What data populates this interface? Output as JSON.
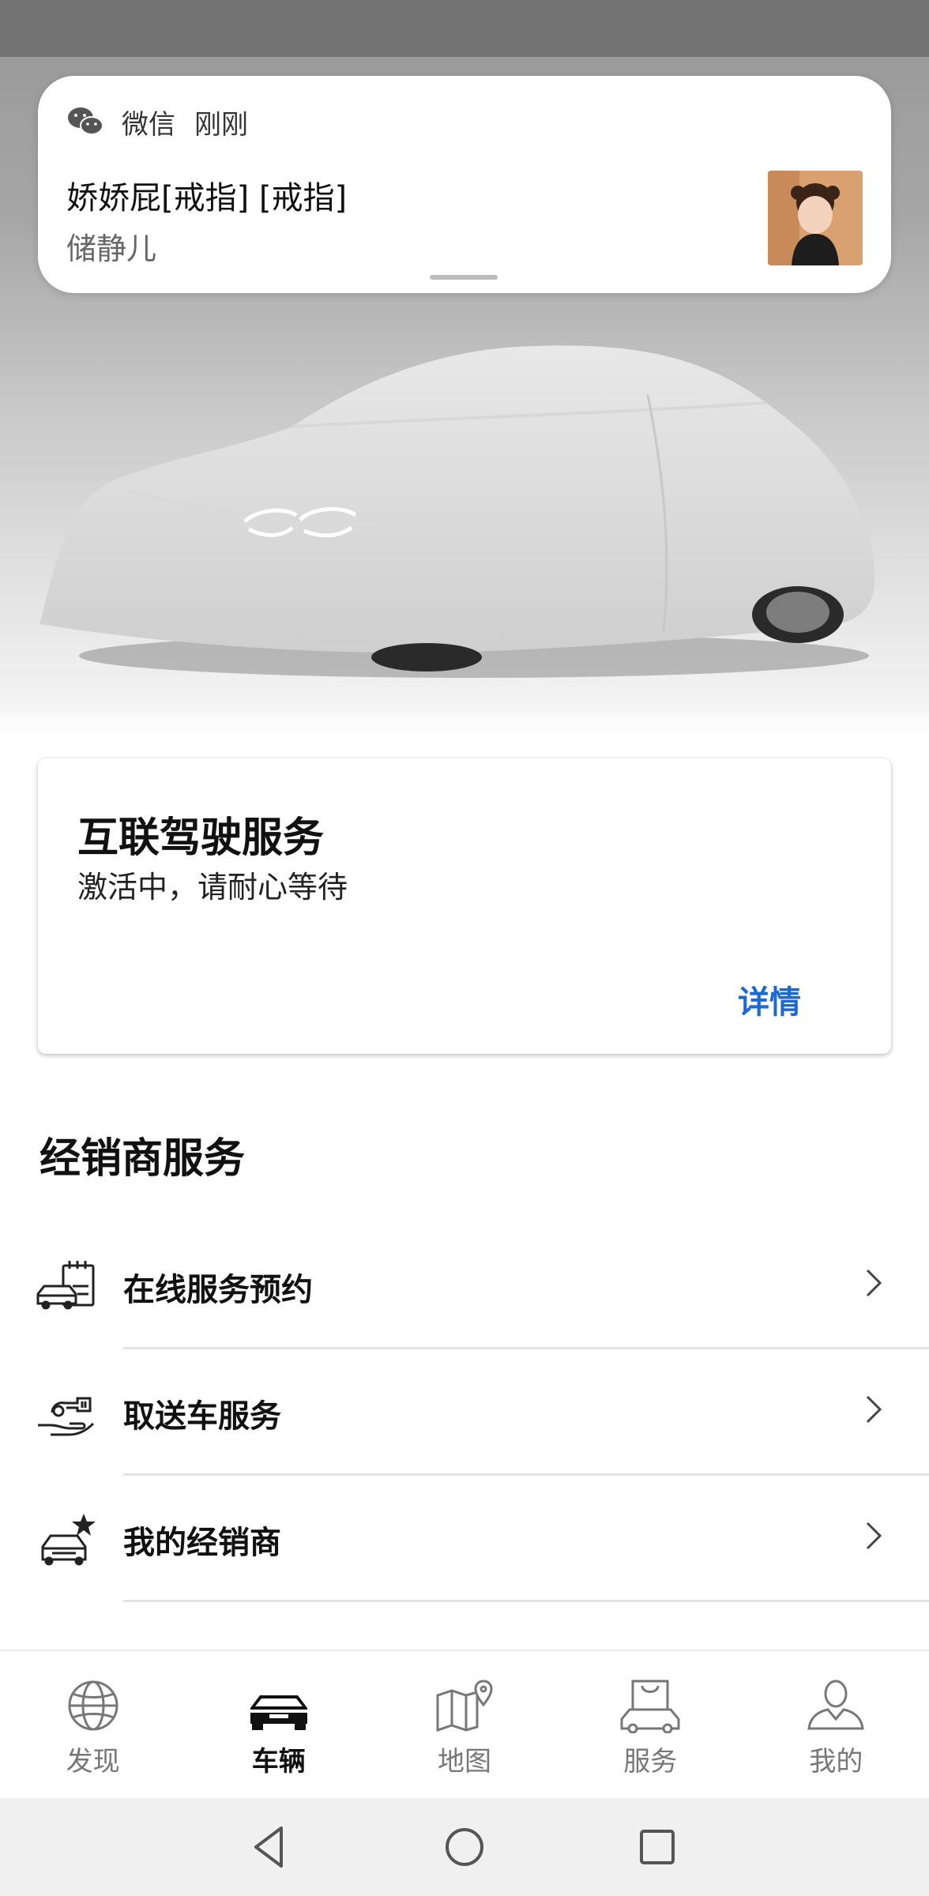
{
  "notification": {
    "app": "微信",
    "time": "刚刚",
    "title": "娇娇屁[戒指] [戒指]",
    "sender": "储静儿",
    "icon": "wechat-icon"
  },
  "connected_service": {
    "title": "互联驾驶服务",
    "status": "激活中，请耐心等待",
    "link": "详情",
    "link_color": "#1c69d4"
  },
  "dealer": {
    "section_title": "经销商服务",
    "items": [
      {
        "label": "在线服务预约",
        "icon": "car-calendar-icon"
      },
      {
        "label": "取送车服务",
        "icon": "key-handover-icon"
      },
      {
        "label": "我的经销商",
        "icon": "car-star-icon"
      }
    ]
  },
  "bottom_nav": {
    "items": [
      {
        "label": "发现",
        "icon": "globe-icon",
        "active": false
      },
      {
        "label": "车辆",
        "icon": "car-icon",
        "active": true
      },
      {
        "label": "地图",
        "icon": "map-pin-icon",
        "active": false
      },
      {
        "label": "服务",
        "icon": "shopping-bag-car-icon",
        "active": false
      },
      {
        "label": "我的",
        "icon": "person-icon",
        "active": false
      }
    ]
  },
  "system_nav": [
    "back-icon",
    "home-icon",
    "recents-icon"
  ]
}
